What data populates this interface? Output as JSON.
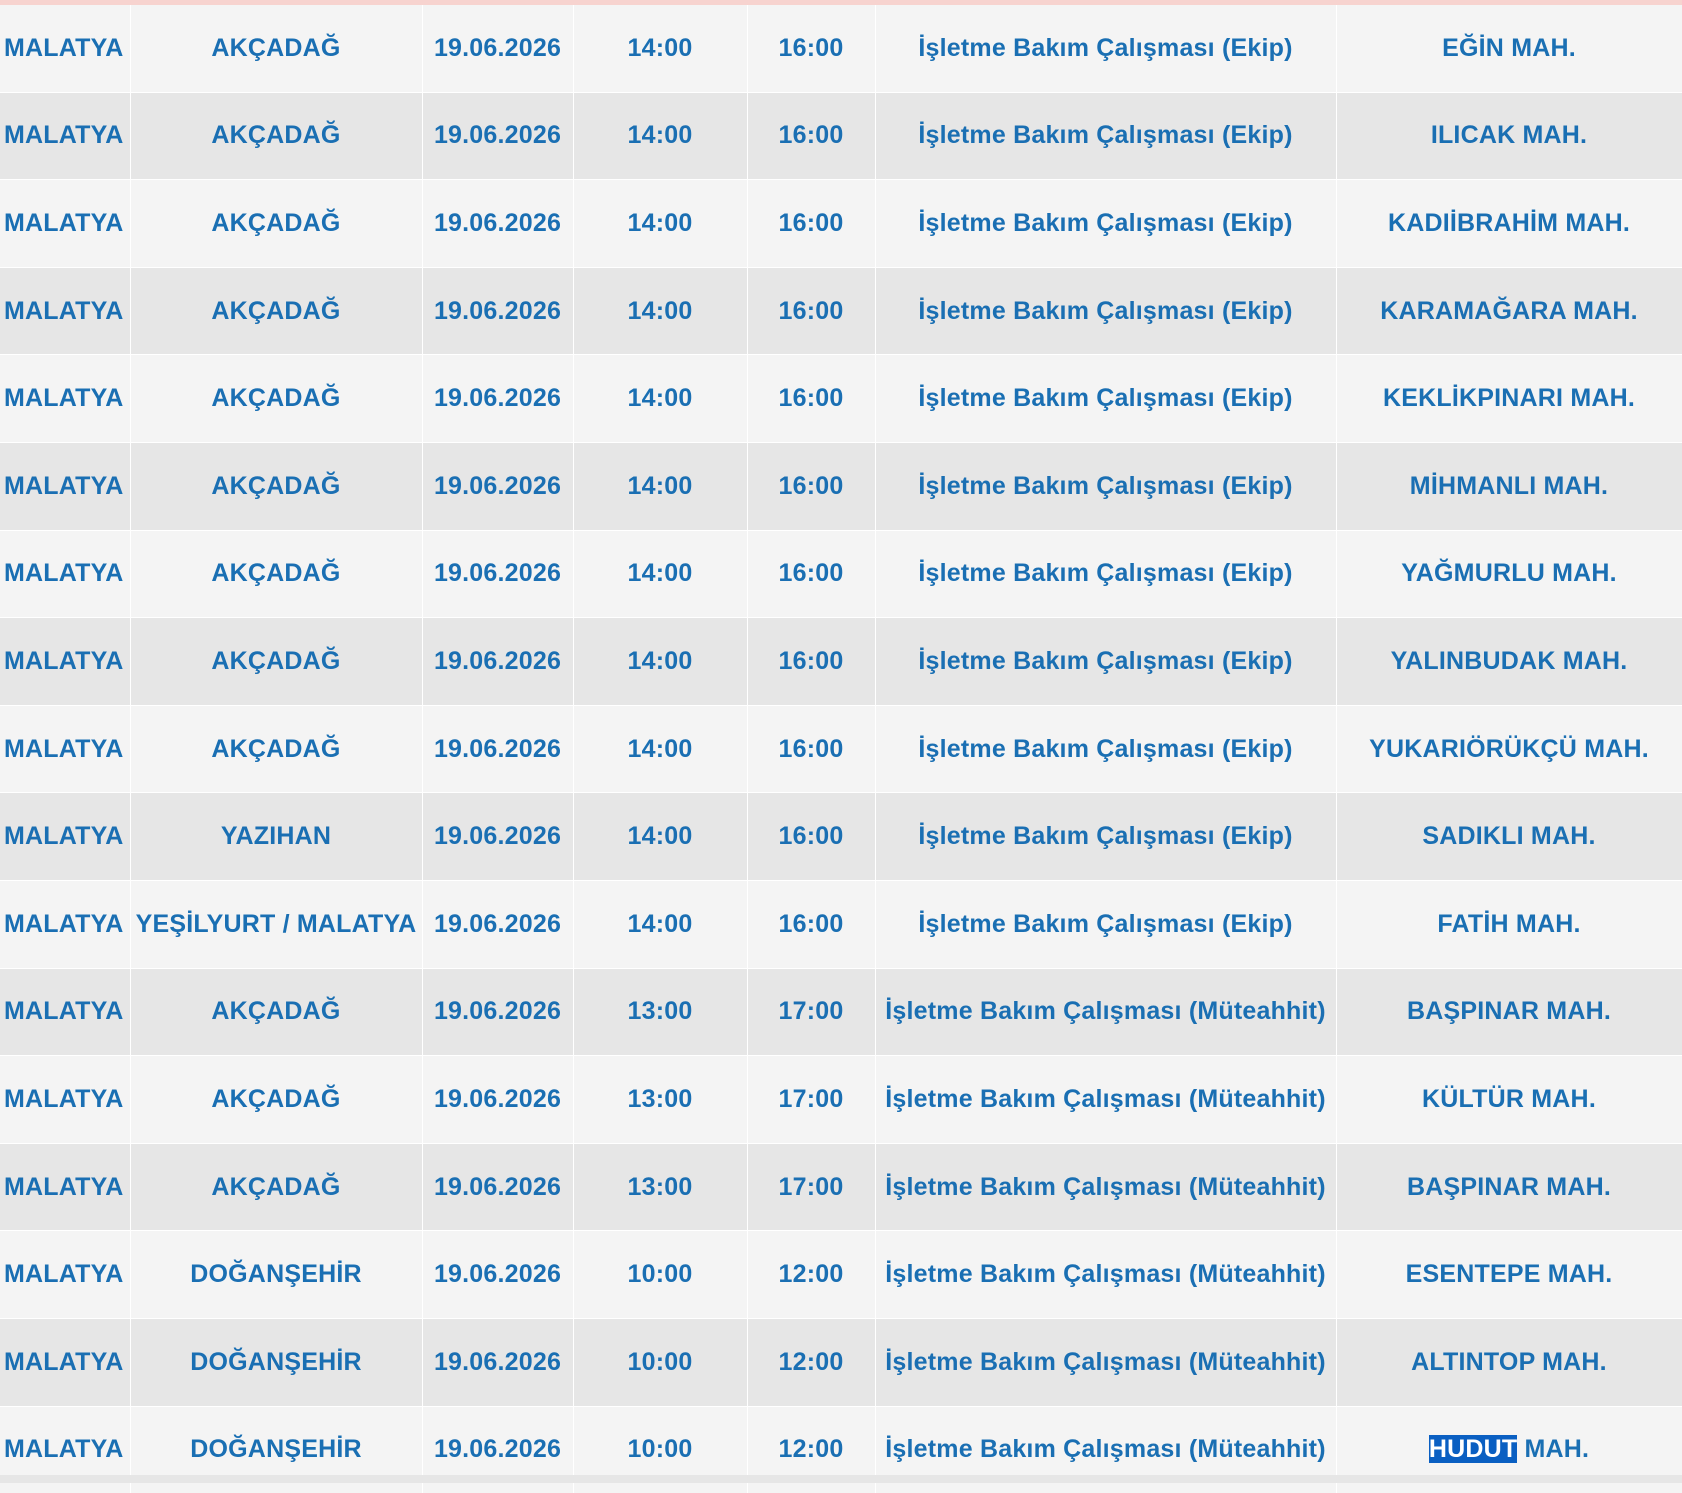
{
  "table": {
    "rows": [
      {
        "il": "MALATYA",
        "ilce": "AKÇADAĞ",
        "tarih": "19.06.2026",
        "baslangic": "14:00",
        "bitis": "16:00",
        "neden": "İşletme Bakım Çalışması (Ekip)",
        "mahalle": "EĞİN MAH."
      },
      {
        "il": "MALATYA",
        "ilce": "AKÇADAĞ",
        "tarih": "19.06.2026",
        "baslangic": "14:00",
        "bitis": "16:00",
        "neden": "İşletme Bakım Çalışması (Ekip)",
        "mahalle": "ILICAK MAH."
      },
      {
        "il": "MALATYA",
        "ilce": "AKÇADAĞ",
        "tarih": "19.06.2026",
        "baslangic": "14:00",
        "bitis": "16:00",
        "neden": "İşletme Bakım Çalışması (Ekip)",
        "mahalle": "KADIİBRAHİM MAH."
      },
      {
        "il": "MALATYA",
        "ilce": "AKÇADAĞ",
        "tarih": "19.06.2026",
        "baslangic": "14:00",
        "bitis": "16:00",
        "neden": "İşletme Bakım Çalışması (Ekip)",
        "mahalle": "KARAMAĞARA MAH."
      },
      {
        "il": "MALATYA",
        "ilce": "AKÇADAĞ",
        "tarih": "19.06.2026",
        "baslangic": "14:00",
        "bitis": "16:00",
        "neden": "İşletme Bakım Çalışması (Ekip)",
        "mahalle": "KEKLİKPINARI MAH."
      },
      {
        "il": "MALATYA",
        "ilce": "AKÇADAĞ",
        "tarih": "19.06.2026",
        "baslangic": "14:00",
        "bitis": "16:00",
        "neden": "İşletme Bakım Çalışması (Ekip)",
        "mahalle": "MİHMANLI MAH."
      },
      {
        "il": "MALATYA",
        "ilce": "AKÇADAĞ",
        "tarih": "19.06.2026",
        "baslangic": "14:00",
        "bitis": "16:00",
        "neden": "İşletme Bakım Çalışması (Ekip)",
        "mahalle": "YAĞMURLU MAH."
      },
      {
        "il": "MALATYA",
        "ilce": "AKÇADAĞ",
        "tarih": "19.06.2026",
        "baslangic": "14:00",
        "bitis": "16:00",
        "neden": "İşletme Bakım Çalışması (Ekip)",
        "mahalle": "YALINBUDAK MAH."
      },
      {
        "il": "MALATYA",
        "ilce": "AKÇADAĞ",
        "tarih": "19.06.2026",
        "baslangic": "14:00",
        "bitis": "16:00",
        "neden": "İşletme Bakım Çalışması (Ekip)",
        "mahalle": "YUKARIÖRÜKÇÜ MAH."
      },
      {
        "il": "MALATYA",
        "ilce": "YAZIHAN",
        "tarih": "19.06.2026",
        "baslangic": "14:00",
        "bitis": "16:00",
        "neden": "İşletme Bakım Çalışması (Ekip)",
        "mahalle": "SADIKLI MAH."
      },
      {
        "il": "MALATYA",
        "ilce": "YEŞİLYURT / MALATYA",
        "tarih": "19.06.2026",
        "baslangic": "14:00",
        "bitis": "16:00",
        "neden": "İşletme Bakım Çalışması (Ekip)",
        "mahalle": "FATİH MAH."
      },
      {
        "il": "MALATYA",
        "ilce": "AKÇADAĞ",
        "tarih": "19.06.2026",
        "baslangic": "13:00",
        "bitis": "17:00",
        "neden": "İşletme Bakım Çalışması (Müteahhit)",
        "mahalle": "BAŞPINAR MAH."
      },
      {
        "il": "MALATYA",
        "ilce": "AKÇADAĞ",
        "tarih": "19.06.2026",
        "baslangic": "13:00",
        "bitis": "17:00",
        "neden": "İşletme Bakım Çalışması (Müteahhit)",
        "mahalle": "KÜLTÜR MAH."
      },
      {
        "il": "MALATYA",
        "ilce": "AKÇADAĞ",
        "tarih": "19.06.2026",
        "baslangic": "13:00",
        "bitis": "17:00",
        "neden": "İşletme Bakım Çalışması (Müteahhit)",
        "mahalle": "BAŞPINAR MAH."
      },
      {
        "il": "MALATYA",
        "ilce": "DOĞANŞEHİR",
        "tarih": "19.06.2026",
        "baslangic": "10:00",
        "bitis": "12:00",
        "neden": "İşletme Bakım Çalışması (Müteahhit)",
        "mahalle": "ESENTEPE MAH."
      },
      {
        "il": "MALATYA",
        "ilce": "DOĞANŞEHİR",
        "tarih": "19.06.2026",
        "baslangic": "10:00",
        "bitis": "12:00",
        "neden": "İşletme Bakım Çalışması (Müteahhit)",
        "mahalle": "ALTINTOP MAH."
      }
    ],
    "last_row": {
      "il": "MALATYA",
      "ilce": "DOĞANŞEHİR",
      "tarih": "19.06.2026",
      "baslangic": "10:00",
      "bitis": "12:00",
      "neden": "İşletme Bakım Çalışması (Müteahhit)",
      "mahalle_highlighted": "HUDUT",
      "mahalle_rest": " MAH."
    }
  },
  "colors": {
    "text": "#1a6fb3",
    "row_light": "#f4f4f4",
    "row_dark": "#e6e6e6",
    "selection": "#0a5fc2",
    "top_accent": "#f7d3cf"
  }
}
